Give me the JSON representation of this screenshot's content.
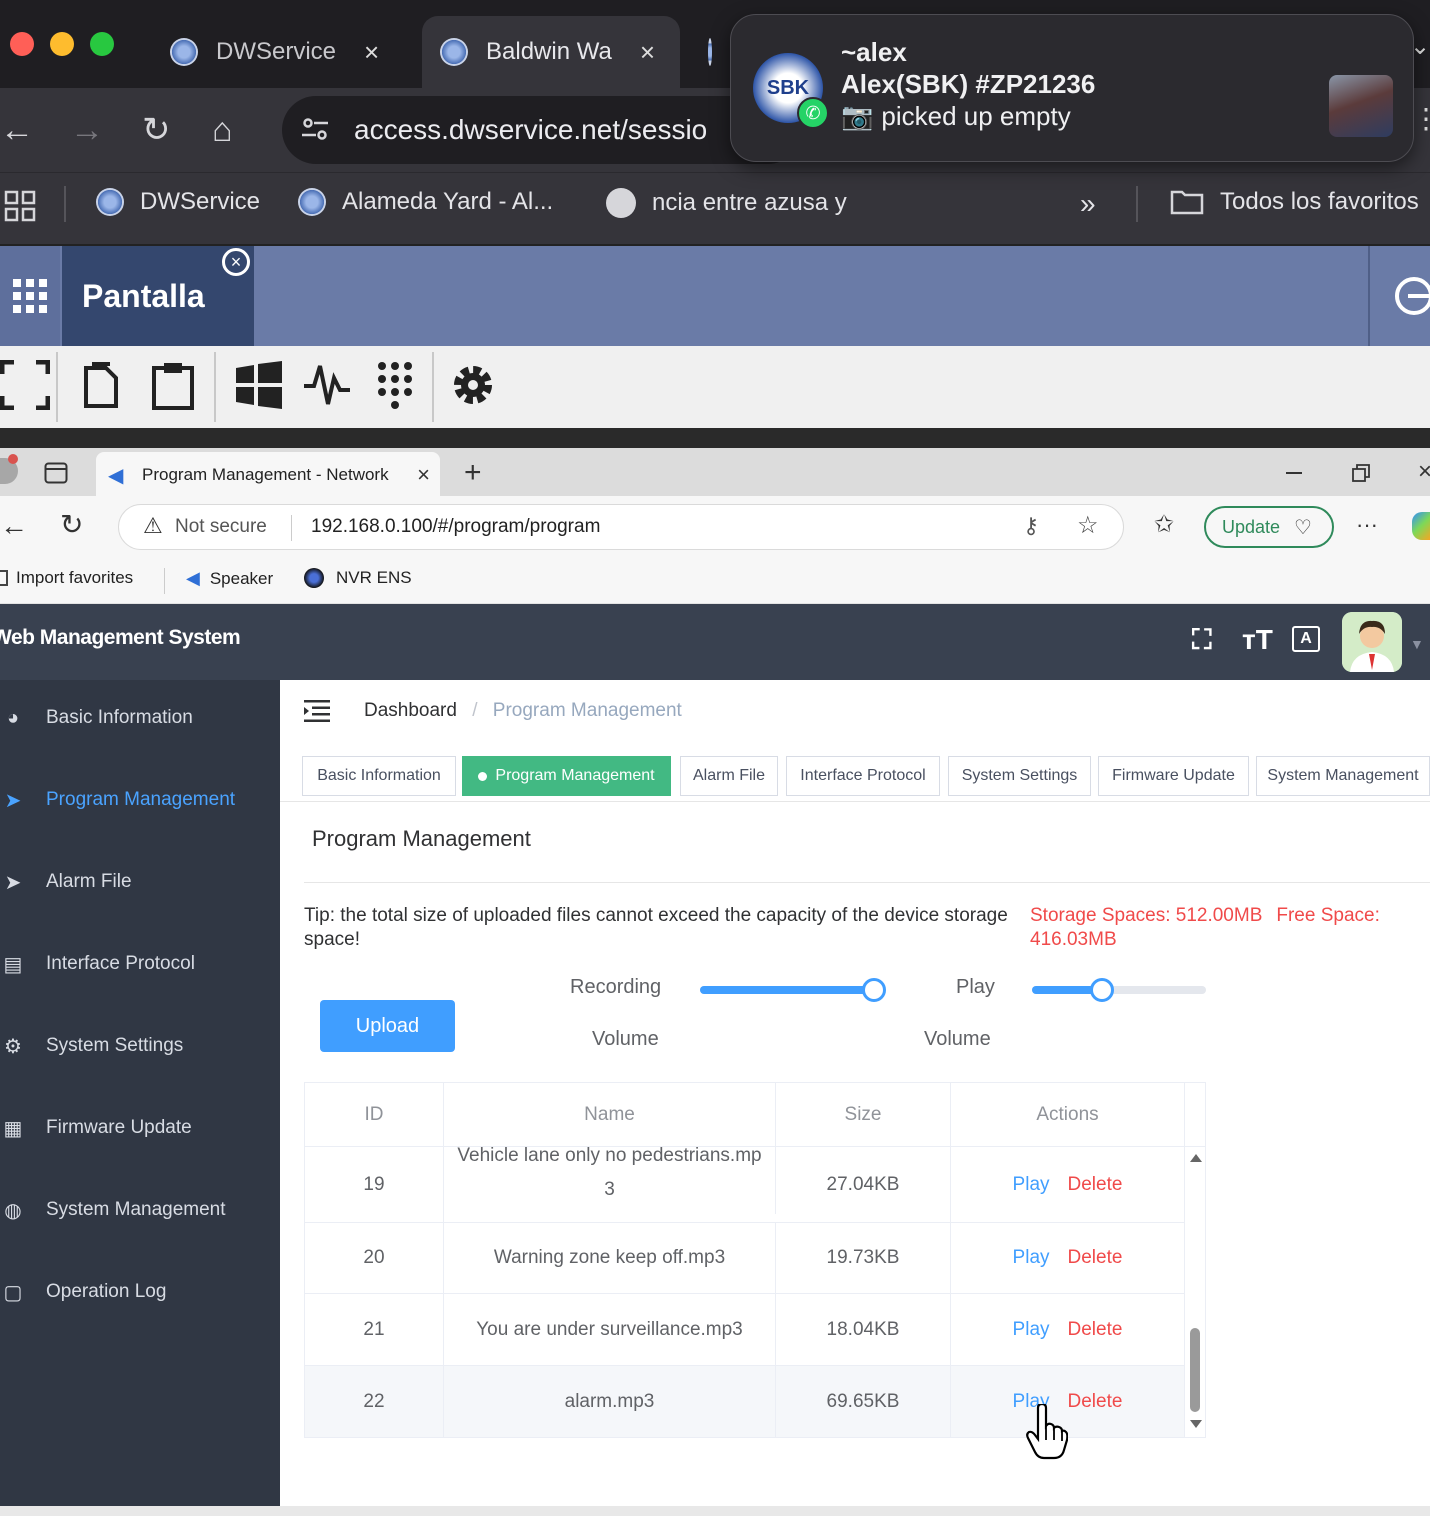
{
  "outer_browser": {
    "tabs": [
      {
        "title": "DWService",
        "close": "×"
      },
      {
        "title": "Baldwin Wa",
        "close": "×"
      }
    ],
    "url": "access.dwservice.net/sessio",
    "bookmarks": [
      "DWService",
      "Alameda Yard - Al...",
      "ncia entre azusa y"
    ],
    "overflow": "»",
    "all_bookmarks": "Todos los favoritos"
  },
  "notification": {
    "sender": "~alex",
    "line1": "Alex(SBK) #ZP21236",
    "line2": "picked up empty",
    "logo_text": "SBK",
    "camera_icon": "📷"
  },
  "dwservice": {
    "tab_label": "Pantalla",
    "tools": [
      "fullscreen-icon",
      "copy-icon",
      "paste-icon",
      "windows-icon",
      "activity-icon",
      "keypad-icon",
      "settings-icon"
    ]
  },
  "inner_browser": {
    "tab_title": "Program Management - Network",
    "tab_close": "×",
    "new_tab": "+",
    "not_secure": "Not secure",
    "url": "192.168.0.100/#/program/program",
    "update_label": "Update",
    "more": "···",
    "bookmarks": [
      "Import favorites",
      "Speaker",
      "NVR ENS"
    ]
  },
  "app": {
    "title": "Web Management System",
    "sidebar": [
      {
        "label": "Basic Information",
        "icon": "dashboard-icon",
        "glyph": "◕",
        "active": false
      },
      {
        "label": "Program Management",
        "icon": "send-icon",
        "glyph": "➤",
        "active": true
      },
      {
        "label": "Alarm File",
        "icon": "send-icon",
        "glyph": "➤",
        "active": false
      },
      {
        "label": "Interface Protocol",
        "icon": "document-icon",
        "glyph": "▤",
        "active": false
      },
      {
        "label": "System Settings",
        "icon": "gear-icon",
        "glyph": "⚙",
        "active": false
      },
      {
        "label": "Firmware Update",
        "icon": "grid-icon",
        "glyph": "▦",
        "active": false
      },
      {
        "label": "System Management",
        "icon": "globe-icon",
        "glyph": "◍",
        "active": false
      },
      {
        "label": "Operation Log",
        "icon": "log-icon",
        "glyph": "▢",
        "active": false
      }
    ],
    "breadcrumb": {
      "home": "Dashboard",
      "separator": "/",
      "current": "Program Management"
    },
    "tabs": [
      "Basic Information",
      "Program Management",
      "Alarm File",
      "Interface Protocol",
      "System Settings",
      "Firmware Update",
      "System Management"
    ],
    "active_tab": "Program Management",
    "page_title": "Program Management",
    "tip": "Tip: the total size of uploaded files cannot exceed the capacity of the device storage space!",
    "storage_spaces": "Storage Spaces: 512.00MB",
    "free_space": "Free Space: 416.03MB",
    "upload_label": "Upload",
    "recording": {
      "label_top": "Recording",
      "label_bottom": "Volume",
      "value_percent": 100
    },
    "play": {
      "label_top": "Play",
      "label_bottom": "Volume",
      "value_percent": 40
    },
    "table": {
      "columns": [
        "ID",
        "Name",
        "Size",
        "Actions"
      ],
      "rows": [
        {
          "id": "19",
          "name": "Vehicle lane only no pedestrians.mp3",
          "size": "27.04KB"
        },
        {
          "id": "20",
          "name": "Warning zone keep off.mp3",
          "size": "19.73KB"
        },
        {
          "id": "21",
          "name": "You are under surveillance.mp3",
          "size": "18.04KB"
        },
        {
          "id": "22",
          "name": "alarm.mp3",
          "size": "69.65KB"
        }
      ],
      "play_label": "Play",
      "delete_label": "Delete"
    }
  },
  "colors": {
    "accent": "#409eff",
    "active_tab": "#42b983",
    "danger": "#f04a4a",
    "sidebar_bg": "#303744",
    "header_bg": "#394150"
  }
}
